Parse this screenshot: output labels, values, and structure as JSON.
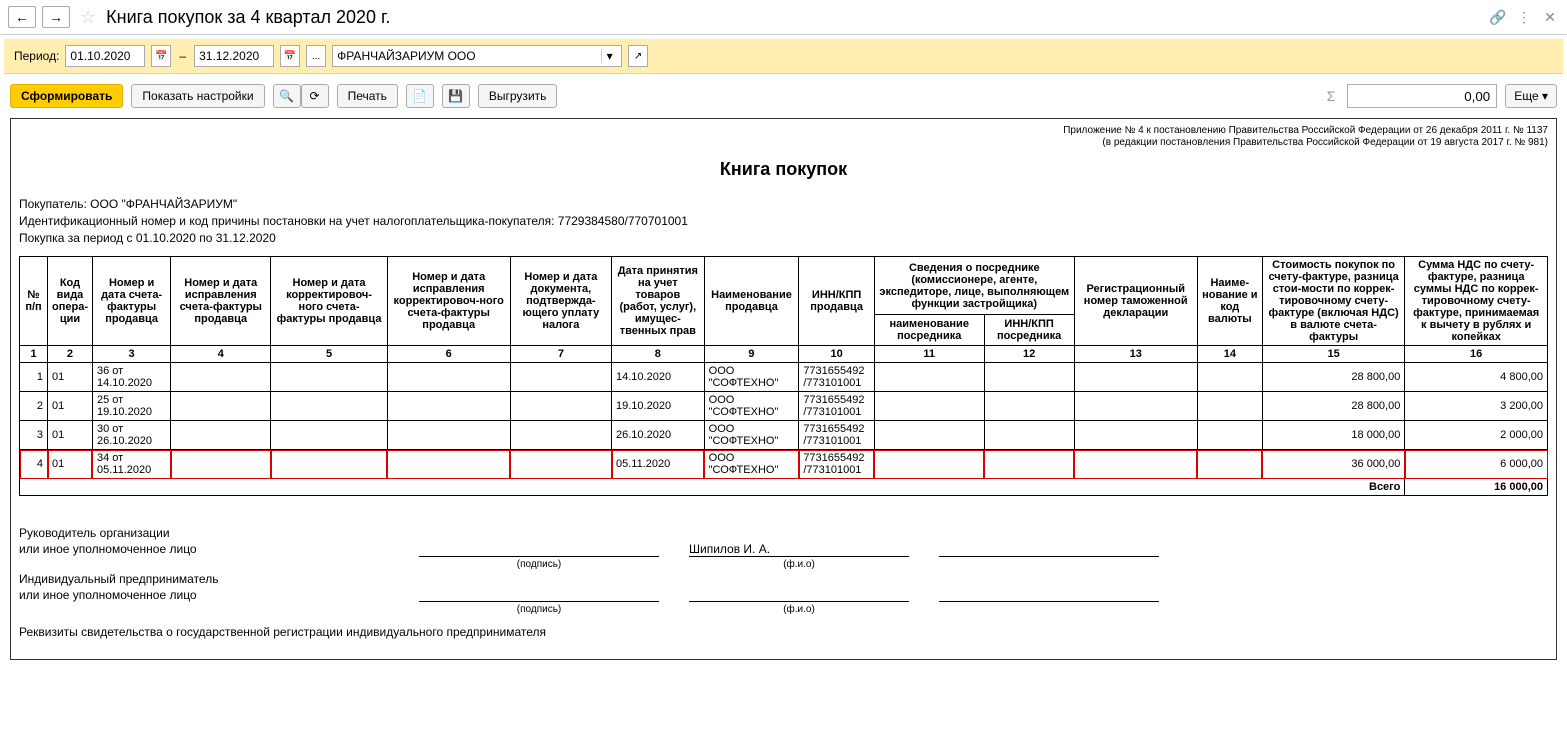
{
  "header": {
    "title": "Книга покупок за 4 квартал 2020 г."
  },
  "filter": {
    "period_label": "Период:",
    "date_from": "01.10.2020",
    "date_to": "31.12.2020",
    "dash": "–",
    "ellipsis": "...",
    "org": "ФРАНЧАЙЗАРИУМ ООО"
  },
  "toolbar": {
    "form_btn": "Сформировать",
    "show_settings_btn": "Показать настройки",
    "print_btn": "Печать",
    "export_btn": "Выгрузить",
    "more_btn": "Еще",
    "sum_value": "0,00"
  },
  "report": {
    "note1": "Приложение № 4 к постановлению Правительства Российской Федерации от 26 декабря 2011 г. № 1137",
    "note2": "(в редакции постановления Правительства Российской Федерации от 19 августа 2017 г. № 981)",
    "title": "Книга покупок",
    "buyer_line": "Покупатель:  ООО \"ФРАНЧАЙЗАРИУМ\"",
    "inn_line": "Идентификационный номер и код причины постановки на учет налогоплательщика-покупателя:  7729384580/770701001",
    "period_line": "Покупка за период с 01.10.2020 по 31.12.2020"
  },
  "columns": {
    "c1": "№ п/п",
    "c2": "Код вида опера-ции",
    "c3": "Номер и дата счета-фактуры продавца",
    "c4": "Номер и дата исправления счета-фактуры продавца",
    "c5": "Номер и дата корректировоч-ного счета-фактуры продавца",
    "c6": "Номер и дата исправления корректировоч-ного счета-фактуры продавца",
    "c7": "Номер и дата документа, подтвержда-ющего уплату налога",
    "c8": "Дата принятия на учет товаров (работ, услуг), имущес-твенных прав",
    "c9": "Наименование продавца",
    "c10": "ИНН/КПП продавца",
    "c11g": "Сведения о посреднике (комиссионере, агенте, экспедиторе, лице, выполняющем функции застройщика)",
    "c11": "наименование посредника",
    "c12": "ИНН/КПП посредника",
    "c13": "Регистрационный номер таможенной декларации",
    "c14": "Наиме-нование и код валюты",
    "c15": "Стоимость покупок по счету-фактуре, разница стои-мости по коррек-тировочному счету-фактуре (включая НДС) в валюте счета-фактуры",
    "c16": "Сумма НДС по счету-фактуре, разница суммы НДС по коррек-тировочному счету-фактуре, принимаемая к вычету в рублях и копейках"
  },
  "colnums": [
    "1",
    "2",
    "3",
    "4",
    "5",
    "6",
    "7",
    "8",
    "9",
    "10",
    "11",
    "12",
    "13",
    "14",
    "15",
    "16"
  ],
  "rows": [
    {
      "n": "1",
      "code": "01",
      "inv": "36 от 14.10.2020",
      "date": "14.10.2020",
      "seller": "ООО \"СОФТЕХНО\"",
      "inn": "7731655492 /773101001",
      "c15": "28 800,00",
      "c16": "4 800,00",
      "hi": false
    },
    {
      "n": "2",
      "code": "01",
      "inv": "25 от 19.10.2020",
      "date": "19.10.2020",
      "seller": "ООО \"СОФТЕХНО\"",
      "inn": "7731655492 /773101001",
      "c15": "28 800,00",
      "c16": "3 200,00",
      "hi": false
    },
    {
      "n": "3",
      "code": "01",
      "inv": "30 от 26.10.2020",
      "date": "26.10.2020",
      "seller": "ООО \"СОФТЕХНО\"",
      "inn": "7731655492 /773101001",
      "c15": "18 000,00",
      "c16": "2 000,00",
      "hi": false
    },
    {
      "n": "4",
      "code": "01",
      "inv": "34 от 05.11.2020",
      "date": "05.11.2020",
      "seller": "ООО \"СОФТЕХНО\"",
      "inn": "7731655492 /773101001",
      "c15": "36 000,00",
      "c16": "6 000,00",
      "hi": true
    }
  ],
  "total": {
    "label": "Всего",
    "value": "16 000,00"
  },
  "sig": {
    "head_label1": "Руководитель организации",
    "head_label2": "или иное уполномоченное лицо",
    "ip_label1": "Индивидуальный предприниматель",
    "ip_label2": "или иное уполномоченное лицо",
    "sign_cap": "(подпись)",
    "fio_cap": "(ф.и.о)",
    "head_name": "Шипилов И. А.",
    "reg_line": "Реквизиты свидетельства о государственной регистрации индивидуального предпринимателя"
  }
}
